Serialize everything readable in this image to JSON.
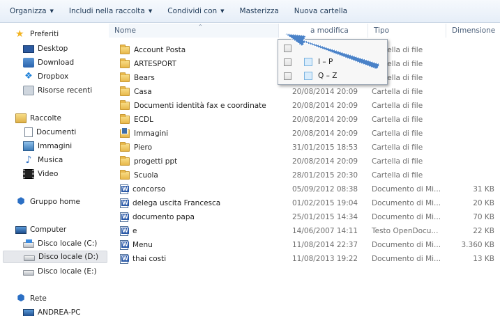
{
  "toolbar": {
    "organize": "Organizza",
    "include": "Includi nella raccolta",
    "share": "Condividi con",
    "burn": "Masterizza",
    "new_folder": "Nuova cartella"
  },
  "nav": {
    "favorites": "Preferiti",
    "desktop": "Desktop",
    "download": "Download",
    "dropbox": "Dropbox",
    "recent": "Risorse recenti",
    "libraries": "Raccolte",
    "documents": "Documenti",
    "pictures": "Immagini",
    "music": "Musica",
    "video": "Video",
    "homegroup": "Gruppo home",
    "computer": "Computer",
    "disk_c": "Disco locale (C:)",
    "disk_d": "Disco locale (D:)",
    "disk_e": "Disco locale (E:)",
    "network": "Rete",
    "pc": "ANDREA-PC"
  },
  "columns": {
    "name": "Nome",
    "date": "a modifica",
    "type": "Tipo",
    "size": "Dimensione"
  },
  "filter": {
    "options": [
      "I – P",
      "Q – Z"
    ]
  },
  "files": [
    {
      "name": "Account Posta",
      "date": "",
      "type": "Cartella di file",
      "size": "",
      "icon": "folder"
    },
    {
      "name": "ARTESPORT",
      "date": "",
      "type": "Cartella di file",
      "size": "",
      "icon": "folder"
    },
    {
      "name": "Bears",
      "date": "",
      "type": "Cartella di file",
      "size": "",
      "icon": "folder"
    },
    {
      "name": "Casa",
      "date": "20/08/2014 20:09",
      "type": "Cartella di file",
      "size": "",
      "icon": "folder"
    },
    {
      "name": "Documenti identità fax e coordinate",
      "date": "20/08/2014 20:09",
      "type": "Cartella di file",
      "size": "",
      "icon": "folder"
    },
    {
      "name": "ECDL",
      "date": "20/08/2014 20:09",
      "type": "Cartella di file",
      "size": "",
      "icon": "folder"
    },
    {
      "name": "Immagini",
      "date": "20/08/2014 20:09",
      "type": "Cartella di file",
      "size": "",
      "icon": "folder-images"
    },
    {
      "name": "Piero",
      "date": "31/01/2015 18:53",
      "type": "Cartella di file",
      "size": "",
      "icon": "folder"
    },
    {
      "name": "progetti ppt",
      "date": "20/08/2014 20:09",
      "type": "Cartella di file",
      "size": "",
      "icon": "folder"
    },
    {
      "name": "Scuola",
      "date": "28/01/2015 20:30",
      "type": "Cartella di file",
      "size": "",
      "icon": "folder"
    },
    {
      "name": "concorso",
      "date": "05/09/2012 08:38",
      "type": "Documento di Mi...",
      "size": "31 KB",
      "icon": "word-doc"
    },
    {
      "name": "delega uscita Francesca",
      "date": "01/02/2015 19:04",
      "type": "Documento di Mi...",
      "size": "20 KB",
      "icon": "word-doc"
    },
    {
      "name": "documento papa",
      "date": "25/01/2015 14:34",
      "type": "Documento di Mi...",
      "size": "70 KB",
      "icon": "word-doc"
    },
    {
      "name": "e",
      "date": "14/06/2007 14:11",
      "type": "Testo OpenDocu...",
      "size": "22 KB",
      "icon": "word-doc"
    },
    {
      "name": "Menu",
      "date": "11/08/2014 22:37",
      "type": "Documento di Mi...",
      "size": "3.360 KB",
      "icon": "word-doc"
    },
    {
      "name": "thai costi",
      "date": "11/08/2013 19:22",
      "type": "Documento di Mi...",
      "size": "13 KB",
      "icon": "word-doc"
    }
  ],
  "colors": {
    "arrow": "#4a82c8"
  }
}
